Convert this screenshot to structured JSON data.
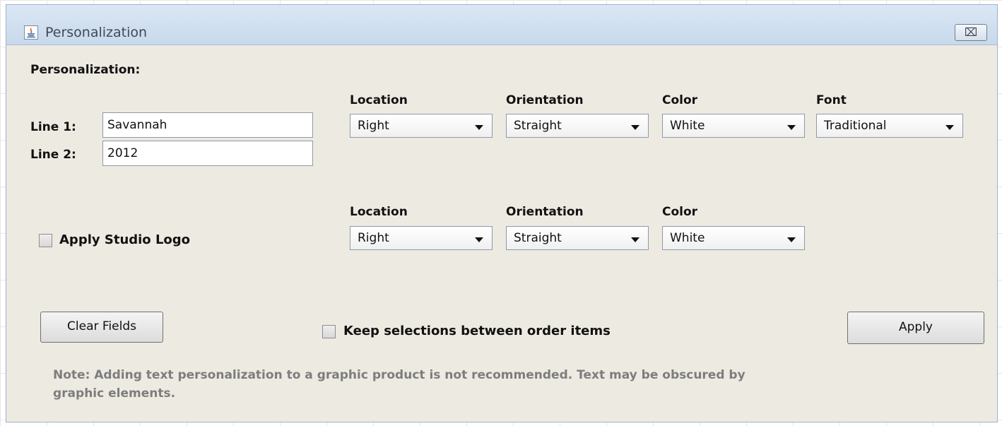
{
  "window": {
    "title": "Personalization",
    "close_glyph": "⌧"
  },
  "section_title": "Personalization:",
  "line1": {
    "label": "Line 1:",
    "value": "Savannah"
  },
  "line2": {
    "label": "Line 2:",
    "value": "2012"
  },
  "text_options": {
    "location": {
      "label": "Location",
      "selected": "Right"
    },
    "orientation": {
      "label": "Orientation",
      "selected": "Straight"
    },
    "color": {
      "label": "Color",
      "selected": "White"
    },
    "font": {
      "label": "Font",
      "selected": "Traditional"
    }
  },
  "logo": {
    "checkbox_label": "Apply Studio Logo",
    "checked": false,
    "location": {
      "label": "Location",
      "selected": "Right"
    },
    "orientation": {
      "label": "Orientation",
      "selected": "Straight"
    },
    "color": {
      "label": "Color",
      "selected": "White"
    }
  },
  "buttons": {
    "clear": "Clear Fields",
    "apply": "Apply"
  },
  "keep_selections": {
    "label": "Keep selections between order items",
    "checked": false
  },
  "note": {
    "line1": "Note: Adding text personalization to a graphic product is not recommended. Text may be obscured by",
    "line2": "graphic elements."
  },
  "colors": {
    "dialog_bg": "#edeae2",
    "titlebar": "#c7d9ec",
    "note_text": "#7d7d7d"
  }
}
